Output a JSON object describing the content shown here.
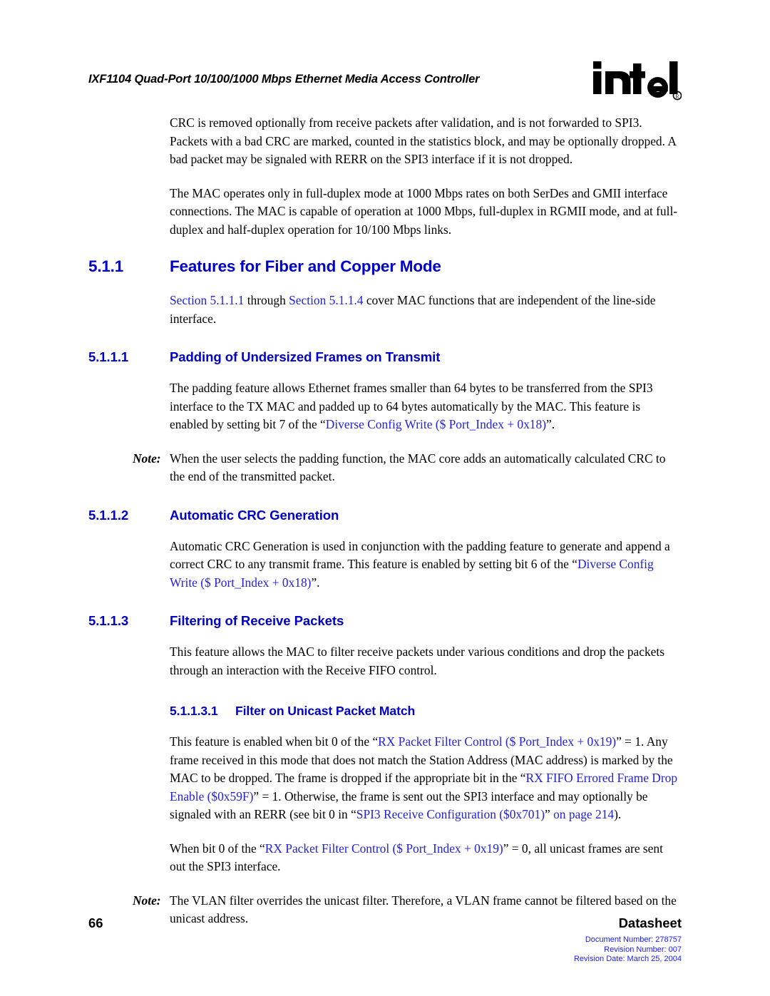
{
  "header": {
    "title": "IXF1104 Quad-Port 10/100/1000 Mbps Ethernet Media Access Controller",
    "logo_text": "intel",
    "logo_mark": "registered-trademark"
  },
  "body": {
    "p_crc": {
      "text": "CRC is removed optionally from receive packets after validation, and is not forwarded to SPI3. Packets with a bad CRC are marked, counted in the statistics block, and may be optionally dropped. A bad packet may be signaled with RERR on the SPI3 interface if it is not dropped."
    },
    "p_mac_duplex": {
      "text": "The MAC operates only in full-duplex mode at 1000 Mbps rates on both SerDes and GMII interface connections. The MAC is capable of operation at 1000 Mbps, full-duplex in RGMII mode, and at full-duplex and half-duplex operation for 10/100 Mbps links."
    }
  },
  "sections": {
    "s511": {
      "number": "5.1.1",
      "title": "Features for Fiber and Copper Mode",
      "intro": {
        "link1": "Section 5.1.1.1",
        "mid": " through ",
        "link2": "Section 5.1.1.4",
        "tail": " cover MAC functions that are independent of the line-side interface."
      }
    },
    "s5111": {
      "number": "5.1.1.1",
      "title": "Padding of Undersized Frames on Transmit",
      "para_head": "The padding feature allows Ethernet frames smaller than 64 bytes to be transferred from the SPI3 interface to the TX MAC and padded up to 64 bytes automatically by the MAC. This feature is enabled by setting bit 7 of the “",
      "para_link": "Diverse Config Write ($ Port_Index + 0x18)",
      "para_tail": "”.",
      "note_label": "Note:",
      "note_text": "When the user selects the padding function, the MAC core adds an automatically calculated CRC to the end of the transmitted packet."
    },
    "s5112": {
      "number": "5.1.1.2",
      "title": "Automatic CRC Generation",
      "para_head": "Automatic CRC Generation is used in conjunction with the padding feature to generate and append a correct CRC to any transmit frame. This feature is enabled by setting bit 6 of the “",
      "para_link": "Diverse Config Write ($ Port_Index + 0x18)",
      "para_tail": "”."
    },
    "s5113": {
      "number": "5.1.1.3",
      "title": "Filtering of Receive Packets",
      "para": "This feature allows the MAC to filter receive packets under various conditions and drop the packets through an interaction with the Receive FIFO control."
    },
    "s51131": {
      "number": "5.1.1.3.1",
      "title": "Filter on Unicast Packet Match",
      "p1_a": "This feature is enabled when bit 0 of the “",
      "p1_link1": "RX Packet Filter Control ($ Port_Index + 0x19)",
      "p1_b": "” = 1. Any frame received in this mode that does not match the Station Address (MAC address) is marked by the MAC to be dropped. The frame is dropped if the appropriate bit in the “",
      "p1_link2": "RX FIFO Errored Frame Drop Enable ($0x59F)",
      "p1_c": "” = 1. Otherwise, the frame is sent out the SPI3 interface and may optionally be signaled with an RERR (see bit 0 in “",
      "p1_link3": "SPI3 Receive Configuration ($0x701)",
      "p1_d": "” ",
      "p1_link4": "on page 214",
      "p1_e": ").",
      "p2_a": "When bit 0 of the “",
      "p2_link1": "RX Packet Filter Control ($ Port_Index + 0x19)",
      "p2_b": "” = 0, all unicast frames are sent out the SPI3 interface.",
      "note_label": "Note:",
      "note_text": "The VLAN filter overrides the unicast filter. Therefore, a VLAN frame cannot be filtered based on the unicast address."
    }
  },
  "footer": {
    "page_number": "66",
    "doc_label": "Datasheet",
    "document_number": "Document Number: 278757",
    "revision_number": "Revision Number: 007",
    "revision_date": "Revision Date: March 25, 2004"
  },
  "colors": {
    "heading_blue": "#0000cc",
    "link_blue": "#2222dd",
    "footer_blue": "#1a1aff",
    "text_black": "#000000"
  }
}
